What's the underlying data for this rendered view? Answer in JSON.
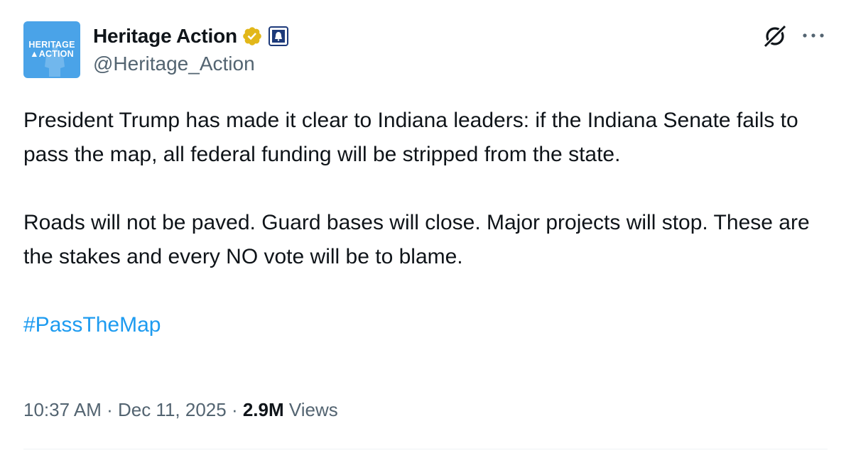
{
  "author": {
    "avatar_text_line1": "HERITAGE",
    "avatar_text_line2": "ACTION",
    "display_name": "Heritage Action",
    "handle": "@Heritage_Action",
    "verified_icon": "verified-gold-badge",
    "affiliate_icon": "liberty-bell-badge"
  },
  "tweet": {
    "paragraph1": "President Trump has made it clear to Indiana leaders: if the Indiana Senate fails to pass the map, all federal funding will be stripped from the state.",
    "paragraph2": "Roads will not be paved. Guard bases will close. Major projects will stop. These are the stakes and every NO vote will be to blame.",
    "hashtag": "#PassTheMap"
  },
  "meta": {
    "time": "10:37 AM",
    "separator1": " · ",
    "date": "Dec 11, 2025",
    "separator2": " · ",
    "views_count": "2.9M",
    "views_label": " Views"
  },
  "icons": {
    "grok": "grok-icon",
    "more": "more-icon"
  },
  "colors": {
    "link": "#1d9bf0",
    "secondary_text": "#536471",
    "avatar_bg": "#4aa3e8",
    "verified_gold": "#e2b719"
  }
}
